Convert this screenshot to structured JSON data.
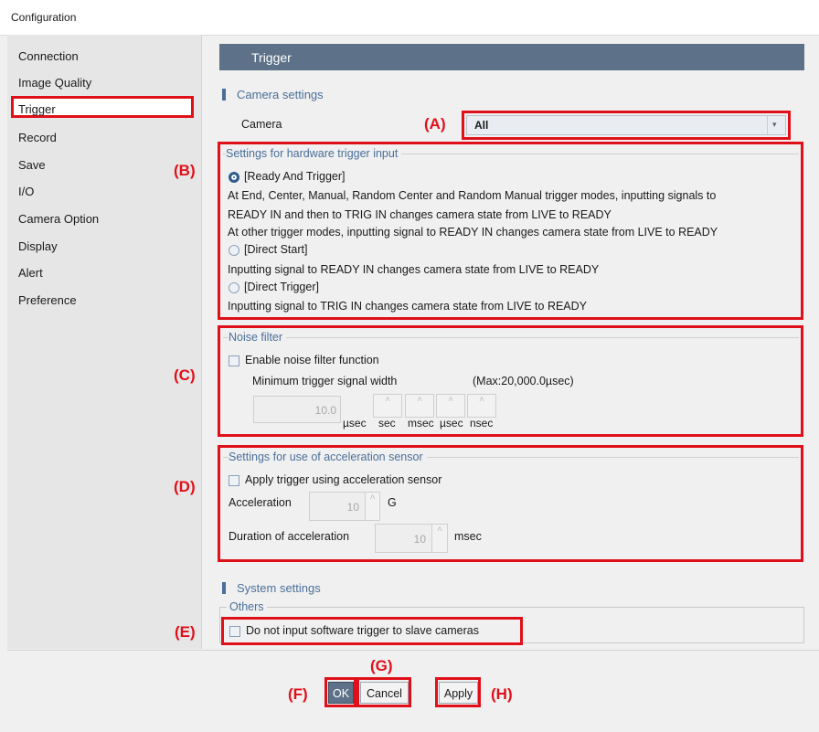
{
  "window": {
    "title": "Configuration"
  },
  "sidebar": {
    "items": [
      {
        "label": "Connection"
      },
      {
        "label": "Image Quality"
      },
      {
        "label": "Trigger"
      },
      {
        "label": "Record"
      },
      {
        "label": "Save"
      },
      {
        "label": "I/O"
      },
      {
        "label": "Camera Option"
      },
      {
        "label": "Display"
      },
      {
        "label": "Alert"
      },
      {
        "label": "Preference"
      }
    ],
    "selected": "Trigger"
  },
  "header": {
    "title": "Trigger"
  },
  "camera_settings": {
    "section_label": "Camera settings",
    "camera_label": "Camera",
    "camera_value": "All",
    "callout": "(A)"
  },
  "hw_trigger": {
    "legend": "Settings for hardware trigger input",
    "callout": "(B)",
    "option1_label": "[Ready And Trigger]",
    "option1_desc1": "At End, Center, Manual, Random Center and Random Manual trigger modes, inputting signals to",
    "option1_desc2": "READY IN and then to TRIG IN changes camera state from LIVE to READY",
    "option1_desc3": "At other trigger modes, inputting signal to READY IN changes camera state from LIVE to READY",
    "option2_label": "[Direct Start]",
    "option2_desc": "Inputting signal to READY IN changes camera state from LIVE to READY",
    "option3_label": "[Direct Trigger]",
    "option3_desc": "Inputting signal to TRIG IN changes camera state from LIVE to READY"
  },
  "noise_filter": {
    "legend": "Noise filter",
    "callout": "(C)",
    "enable_label": "Enable noise filter function",
    "min_width_label": "Minimum trigger signal width",
    "max_label": "(Max:20,000.0µsec)",
    "value": "10.0",
    "unit": "µsec",
    "spin_labels": [
      "sec",
      "msec",
      "µsec",
      "nsec"
    ]
  },
  "accel": {
    "legend": "Settings for use of acceleration sensor",
    "callout": "(D)",
    "apply_label": "Apply trigger using acceleration sensor",
    "accel_label": "Acceleration",
    "accel_value": "10",
    "accel_unit": "G",
    "duration_label": "Duration of acceleration",
    "duration_value": "10",
    "duration_unit": "msec"
  },
  "system_settings": {
    "section_label": "System settings",
    "others_legend": "Others",
    "callout": "(E)",
    "no_software_trigger_label": "Do not input software trigger to slave cameras"
  },
  "buttons": {
    "ok": "OK",
    "cancel": "Cancel",
    "apply": "Apply",
    "callout_f": "(F)",
    "callout_g": "(G)",
    "callout_h": "(H)"
  },
  "colors": {
    "accent": "#5d7288",
    "callout_red": "#e0101a",
    "section_blue": "#4a6f9a"
  }
}
